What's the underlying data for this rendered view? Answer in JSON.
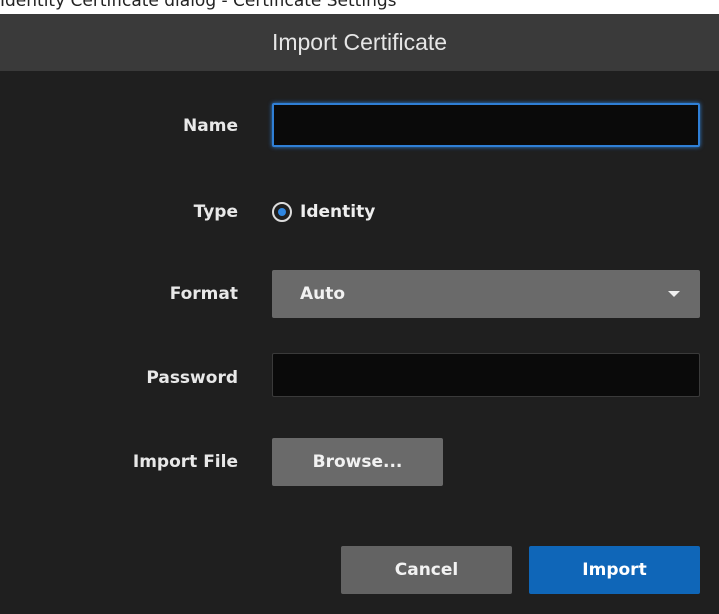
{
  "page_caption": "Identity Certificate dialog - Certificate Settings",
  "dialog": {
    "title": "Import Certificate",
    "fields": {
      "name": {
        "label": "Name",
        "value": ""
      },
      "type": {
        "label": "Type",
        "option": "Identity",
        "selected": true
      },
      "format": {
        "label": "Format",
        "value": "Auto"
      },
      "password": {
        "label": "Password",
        "value": ""
      },
      "import_file": {
        "label": "Import File",
        "button": "Browse..."
      }
    },
    "actions": {
      "cancel": "Cancel",
      "import": "Import"
    }
  },
  "colors": {
    "dialog_bg": "#1f1f1f",
    "header_bg": "#3a3a3a",
    "focus_accent": "#2f7fd6",
    "primary_button": "#0f66b8",
    "secondary_button": "#636363"
  }
}
